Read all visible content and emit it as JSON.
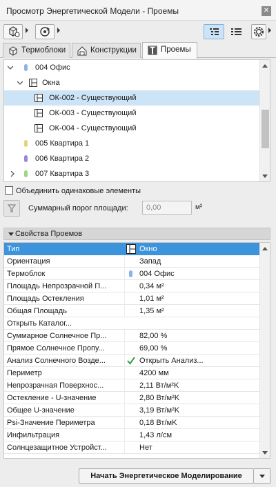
{
  "window": {
    "title": "Просмотр Энергетической Модели - Проемы"
  },
  "tabs": [
    {
      "label": "Термоблоки"
    },
    {
      "label": "Конструкции"
    },
    {
      "label": "Проемы"
    }
  ],
  "tree": {
    "items": [
      {
        "label": "004 Офис",
        "color": "#8fb3e8",
        "expanded": true
      },
      {
        "label": "Окна",
        "expanded": true
      },
      {
        "label": "ОК-002 - Существующий",
        "selected": true
      },
      {
        "label": "ОК-003 - Существующий"
      },
      {
        "label": "ОК-004 - Существующий"
      },
      {
        "label": "005 Квартира 1",
        "color": "#e8d37a"
      },
      {
        "label": "006 Квартира 2",
        "color": "#9c88d6"
      },
      {
        "label": "007 Квартира 3",
        "color": "#9fd67f"
      }
    ]
  },
  "merge_label": "Объединить одинаковые элементы",
  "filter": {
    "label": "Суммарный порог площади:",
    "value": "0,00",
    "unit": "м²"
  },
  "section_title": "Свойства Проемов",
  "properties": [
    {
      "name": "Тип",
      "value": "Окно",
      "icon": "window-icon",
      "selected": true
    },
    {
      "name": "Ориентация",
      "value": "Запад"
    },
    {
      "name": "Термоблок",
      "value": "004 Офис",
      "icon": "zone-color-icon",
      "color": "#8fb3e8"
    },
    {
      "name": "Площадь Непрозрачной П...",
      "value": "0,34 м²"
    },
    {
      "name": "Площадь Остекления",
      "value": "1,01 м²"
    },
    {
      "name": "Общая Площадь",
      "value": "1,35 м²"
    },
    {
      "name": "Открыть Каталог...",
      "value": ""
    },
    {
      "name": "Суммарное Солнечное Пр...",
      "value": "82,00 %"
    },
    {
      "name": "Прямое Солнечное Пропу...",
      "value": "69,00 %"
    },
    {
      "name": "Анализ Солнечного Возде...",
      "value": "Открыть Анализ...",
      "icon": "check-icon"
    },
    {
      "name": "Периметр",
      "value": "4200 мм"
    },
    {
      "name": "Непрозрачная Поверхнос...",
      "value": "2,11 Вт/м²K"
    },
    {
      "name": "Остекление - U-значение",
      "value": "2,80 Вт/м²K"
    },
    {
      "name": "Общее U-значение",
      "value": "3,19 Вт/м²K"
    },
    {
      "name": "Psi-Значение Периметра",
      "value": "0,18 Вт/мK"
    },
    {
      "name": "Инфильтрация",
      "value": "1,43 л/см"
    },
    {
      "name": "Солнцезащитное Устройст...",
      "value": "Нет"
    }
  ],
  "footer": {
    "start_label": "Начать Энергетическое Моделирование"
  }
}
